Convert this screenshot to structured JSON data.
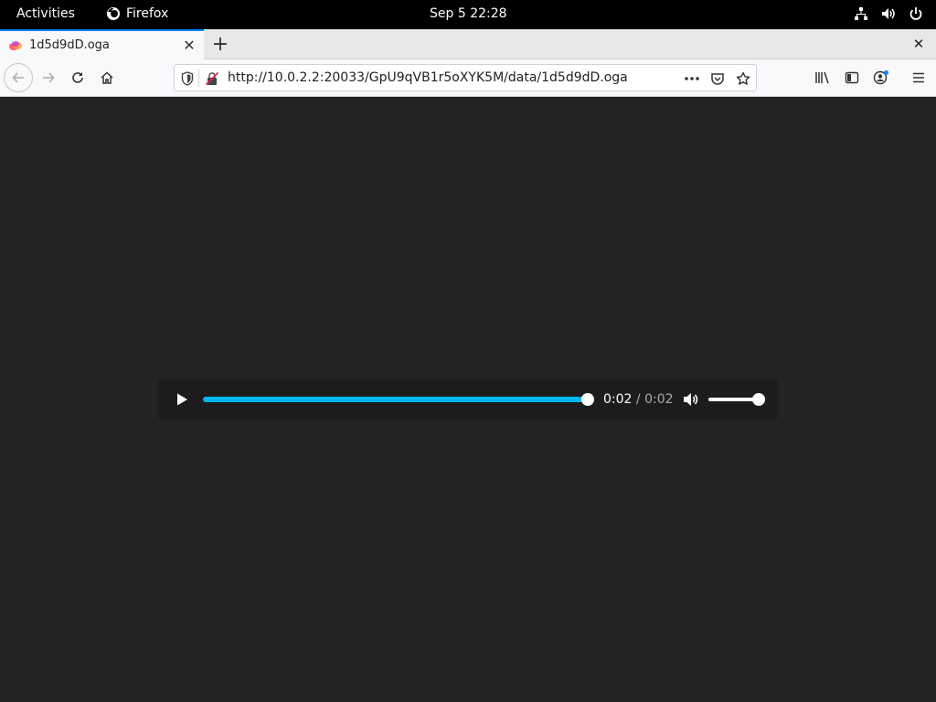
{
  "topbar": {
    "activities": "Activities",
    "app_name": "Firefox",
    "clock": "Sep 5  22:28",
    "icons": [
      "network-icon",
      "volume-icon",
      "power-icon"
    ]
  },
  "browser": {
    "tab_title": "1d5d9dD.oga",
    "url": "http://10.0.2.2:20033/GpU9qVB1r5oXYK5M/data/1d5d9dD.oga"
  },
  "player": {
    "current_time": "0:02",
    "separator": " / ",
    "duration": "0:02",
    "progress_fraction": 1.0,
    "volume_fraction": 1.0,
    "accent": "#00b6f0"
  },
  "colors": {
    "page_bg": "#232323",
    "player_bg": "#1c1c1c",
    "topbar_bg": "#000000"
  }
}
